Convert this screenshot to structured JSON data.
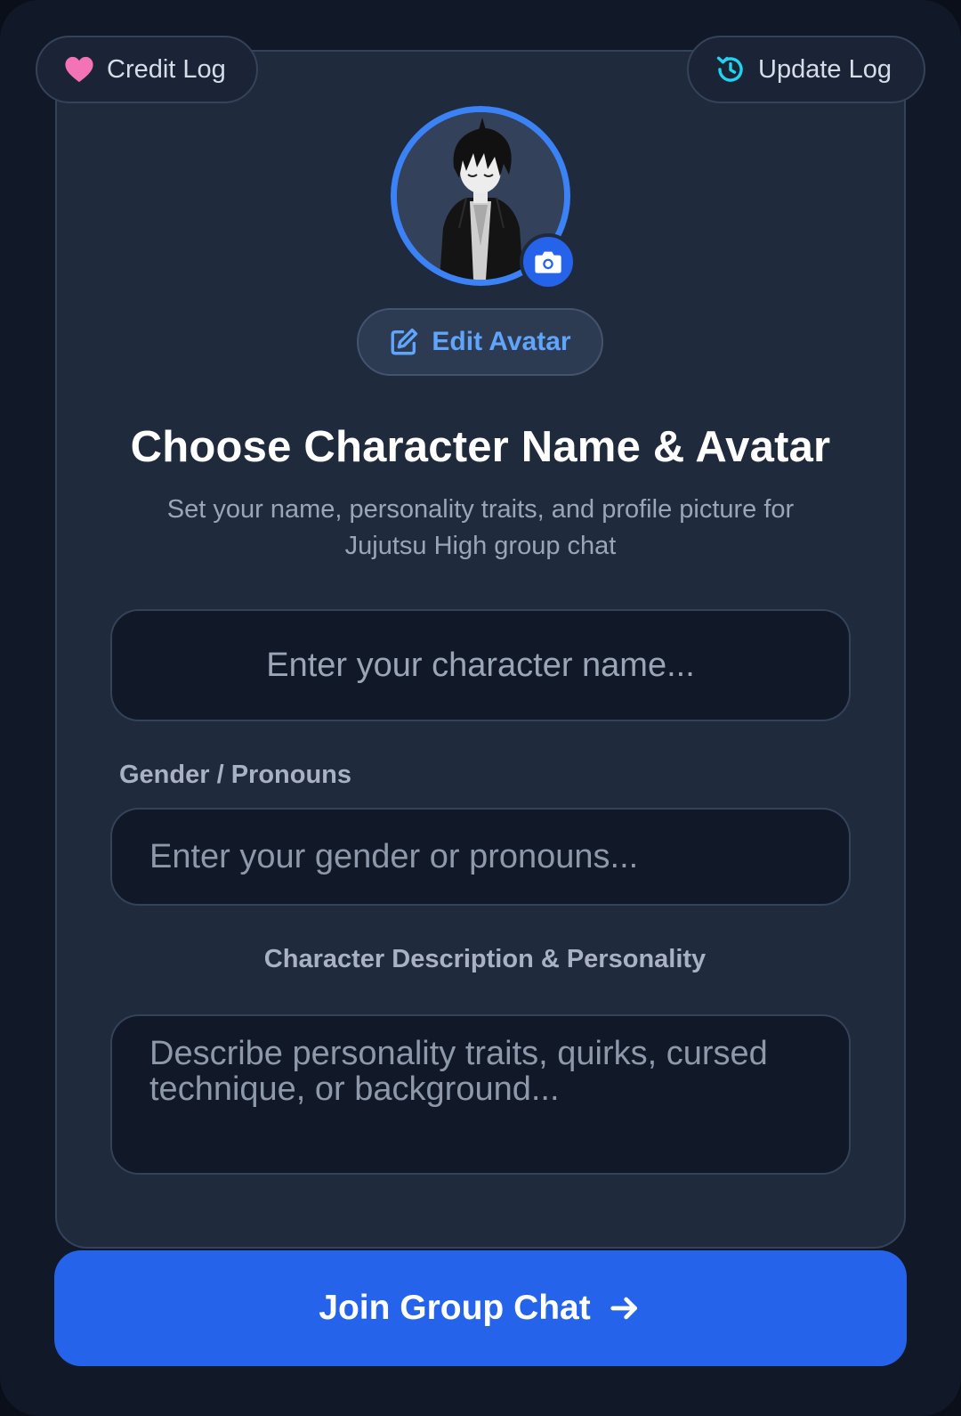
{
  "header": {
    "credit_log_label": "Credit Log",
    "update_log_label": "Update Log"
  },
  "avatar": {
    "edit_label": "Edit Avatar"
  },
  "main": {
    "title": "Choose Character Name & Avatar",
    "subtitle": "Set your name, personality traits, and profile picture for Jujutsu High group chat"
  },
  "form": {
    "name_placeholder": "Enter your character name...",
    "gender_label": "Gender / Pronouns",
    "gender_placeholder": "Enter your gender or pronouns...",
    "description_label": "Character Description & Personality",
    "description_placeholder": "Describe personality traits, quirks, cursed technique, or background..."
  },
  "actions": {
    "join_label": "Join Group Chat"
  },
  "icons": {
    "credit": "heart-icon",
    "update": "history-icon",
    "camera": "camera-icon",
    "edit": "edit-icon",
    "join": "arrow-right-icon"
  },
  "colors": {
    "accent": "#2563eb",
    "accent_light": "#60a5fa",
    "heart": "#f472b6",
    "history": "#22d3ee",
    "background": "#111827",
    "card": "#1f2a3d"
  }
}
